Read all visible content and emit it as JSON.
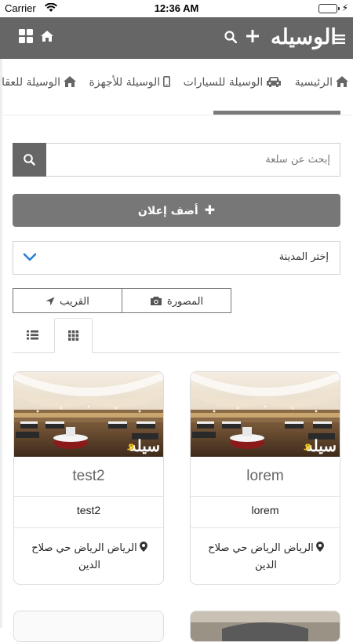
{
  "status_bar": {
    "carrier": "Carrier",
    "time": "12:36 AM"
  },
  "header": {
    "logo": "الوسيله"
  },
  "categories": [
    {
      "label": "الرئيسية",
      "icon": "home-icon"
    },
    {
      "label": "الوسيلة للسيارات",
      "icon": "car-icon"
    },
    {
      "label": "الوسيلة للأجهزة",
      "icon": "mobile-icon"
    },
    {
      "label": "الوسيلة للعقارات",
      "icon": "home-icon"
    }
  ],
  "search": {
    "placeholder": "إبحث عن سلعة"
  },
  "add_ad": {
    "label": "أضف إعلان"
  },
  "city_select": {
    "value": "إختر المدينة"
  },
  "filters": {
    "photos": "المصورة",
    "nearby": "القريب"
  },
  "listings": [
    {
      "title": "lorem",
      "description": "lorem",
      "location": "الرياض الرياض حي صلاح الدين"
    },
    {
      "title": "test2",
      "description": "test2",
      "location": "الرياض الرياض حي صلاح الدين"
    }
  ],
  "colors": {
    "header_bg": "#666666",
    "button_bg": "#777777",
    "accent": "#2a7fd4",
    "logo_dot": "#f2c40f"
  }
}
